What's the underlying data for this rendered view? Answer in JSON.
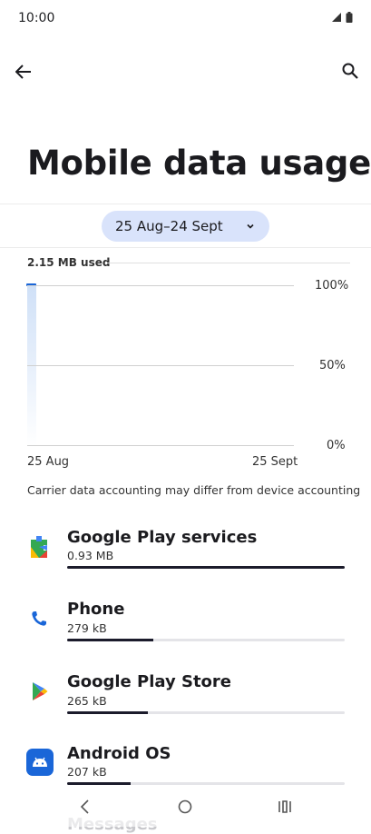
{
  "status_bar": {
    "time": "10:00"
  },
  "page": {
    "title": "Mobile data usage"
  },
  "cycle": {
    "label": "25 Aug–24 Sept"
  },
  "chart": {
    "used_label": "2.15 MB used",
    "y_labels": [
      "100%",
      "50%",
      "0%"
    ],
    "x_labels": [
      "25 Aug",
      "25 Sept"
    ],
    "note": "Carrier data accounting may differ from device accounting"
  },
  "apps": [
    {
      "name": "Google Play services",
      "size": "0.93 MB",
      "fraction": 1.0,
      "icon": "google-play-services-icon"
    },
    {
      "name": "Phone",
      "size": "279 kB",
      "fraction": 0.31,
      "icon": "phone-app-icon"
    },
    {
      "name": "Google Play Store",
      "size": "265 kB",
      "fraction": 0.29,
      "icon": "google-play-store-icon"
    },
    {
      "name": "Android OS",
      "size": "207 kB",
      "fraction": 0.23,
      "icon": "android-os-icon"
    }
  ],
  "partial_item": {
    "name": "Messages"
  },
  "colors": {
    "accent": "#1a66d8",
    "pill_bg": "#d9e3fb"
  }
}
